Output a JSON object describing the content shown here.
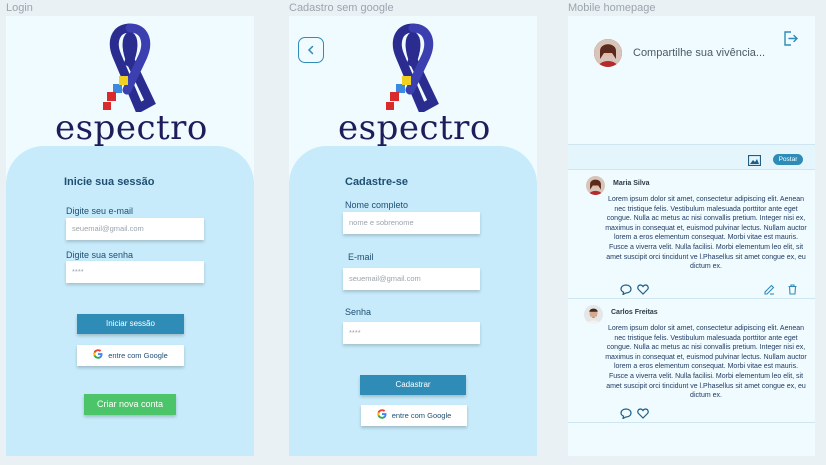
{
  "frames": {
    "login": "Login",
    "signup": "Cadastro sem google",
    "home": "Mobile homepage"
  },
  "brand": {
    "name": "espectro"
  },
  "login": {
    "title": "Inicie sua sessão",
    "email_label": "Digite seu e-mail",
    "email_placeholder": "seuemail@gmail.com",
    "password_label": "Digite sua senha",
    "password_placeholder": "****",
    "submit": "Iniciar sessão",
    "google": "entre com Google",
    "create_account": "Criar nova conta"
  },
  "signup": {
    "title": "Cadastre-se",
    "name_label": "Nome completo",
    "name_placeholder": "nome e sobrenome",
    "email_label": "E-mail",
    "email_placeholder": "seuemail@gmail.com",
    "password_label": "Senha",
    "password_placeholder": "****",
    "submit": "Cadastrar",
    "google": "entre com Google"
  },
  "home": {
    "share_prompt": "Compartilhe sua vivência...",
    "post_button": "Postar",
    "posts": [
      {
        "author": "Maria Silva",
        "text": "Lorem ipsum dolor sit amet, consectetur adipiscing elit. Aenean nec tristique felis. Vestibulum malesuada porttitor ante eget congue. Nulla ac metus ac nisi convallis pretium. Integer nisi ex, maximus in consequat et, euismod pulvinar lectus. Nullam auctor lorem a eros elementum consequat. Morbi vitae est mauris. Fusce a viverra velit. Nulla facilisi. Morbi elementum leo elit, sit amet suscipit orci tincidunt ve l.Phasellus sit amet congue ex, eu dictum ex."
      },
      {
        "author": "Carlos Freitas",
        "text": "Lorem ipsum dolor sit amet, consectetur adipiscing elit. Aenean nec tristique felis. Vestibulum malesuada porttitor ante eget congue. Nulla ac metus ac nisi convallis pretium. Integer nisi ex, maximus in consequat et, euismod pulvinar lectus. Nullam auctor lorem a eros elementum consequat. Morbi vitae est mauris. Fusce a viverra velit. Nulla facilisi. Morbi elementum leo elit, sit amet suscipit orci tincidunt ve l.Phasellus sit amet congue ex, eu dictum ex."
      }
    ]
  },
  "colors": {
    "accent": "#2e8cb6",
    "panel": "#c7ebfa",
    "background": "#f0fbff",
    "success": "#4cc46a",
    "brand_text": "#1f1c5c"
  }
}
